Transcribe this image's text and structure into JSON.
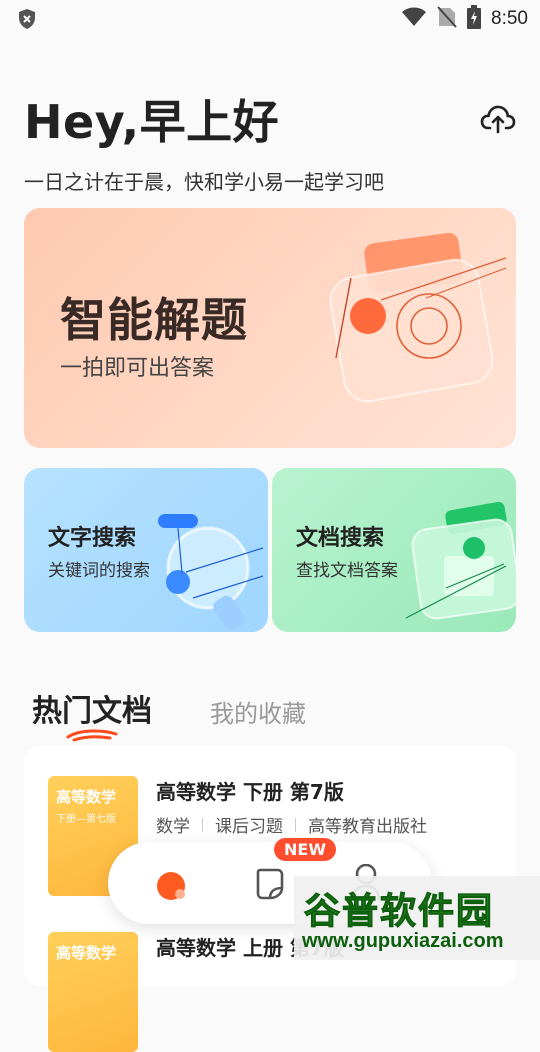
{
  "status_bar": {
    "time": "8:50"
  },
  "header": {
    "greeting": "Hey,早上好",
    "subtitle": "一日之计在于晨，快和学小易一起学习吧"
  },
  "hero": {
    "title": "智能解题",
    "subtitle": "一拍即可出答案"
  },
  "cards": [
    {
      "title": "文字搜索",
      "subtitle": "关键词的搜索"
    },
    {
      "title": "文档搜索",
      "subtitle": "查找文档答案"
    }
  ],
  "tabs": {
    "active": "热门文档",
    "inactive": "我的收藏"
  },
  "documents": [
    {
      "title": "高等数学 下册 第7版",
      "thumb_title": "高等数学",
      "thumb_sub": "下册—第七版",
      "meta": [
        "数学",
        "课后习题",
        "高等教育出版社"
      ]
    },
    {
      "title": "高等数学 上册 第7版",
      "thumb_title": "高等数学",
      "thumb_sub": "",
      "meta": []
    }
  ],
  "bottom_nav": {
    "badge": "NEW"
  },
  "watermark": {
    "name": "谷普软件园",
    "url": "www.gupuxiazai.com"
  },
  "colors": {
    "accent": "#ff5a1f",
    "hero_bg": "#ffc9b0",
    "blue_card": "#b6e2ff",
    "green_card": "#b8f3cf",
    "thumb": "#ffc04a"
  }
}
